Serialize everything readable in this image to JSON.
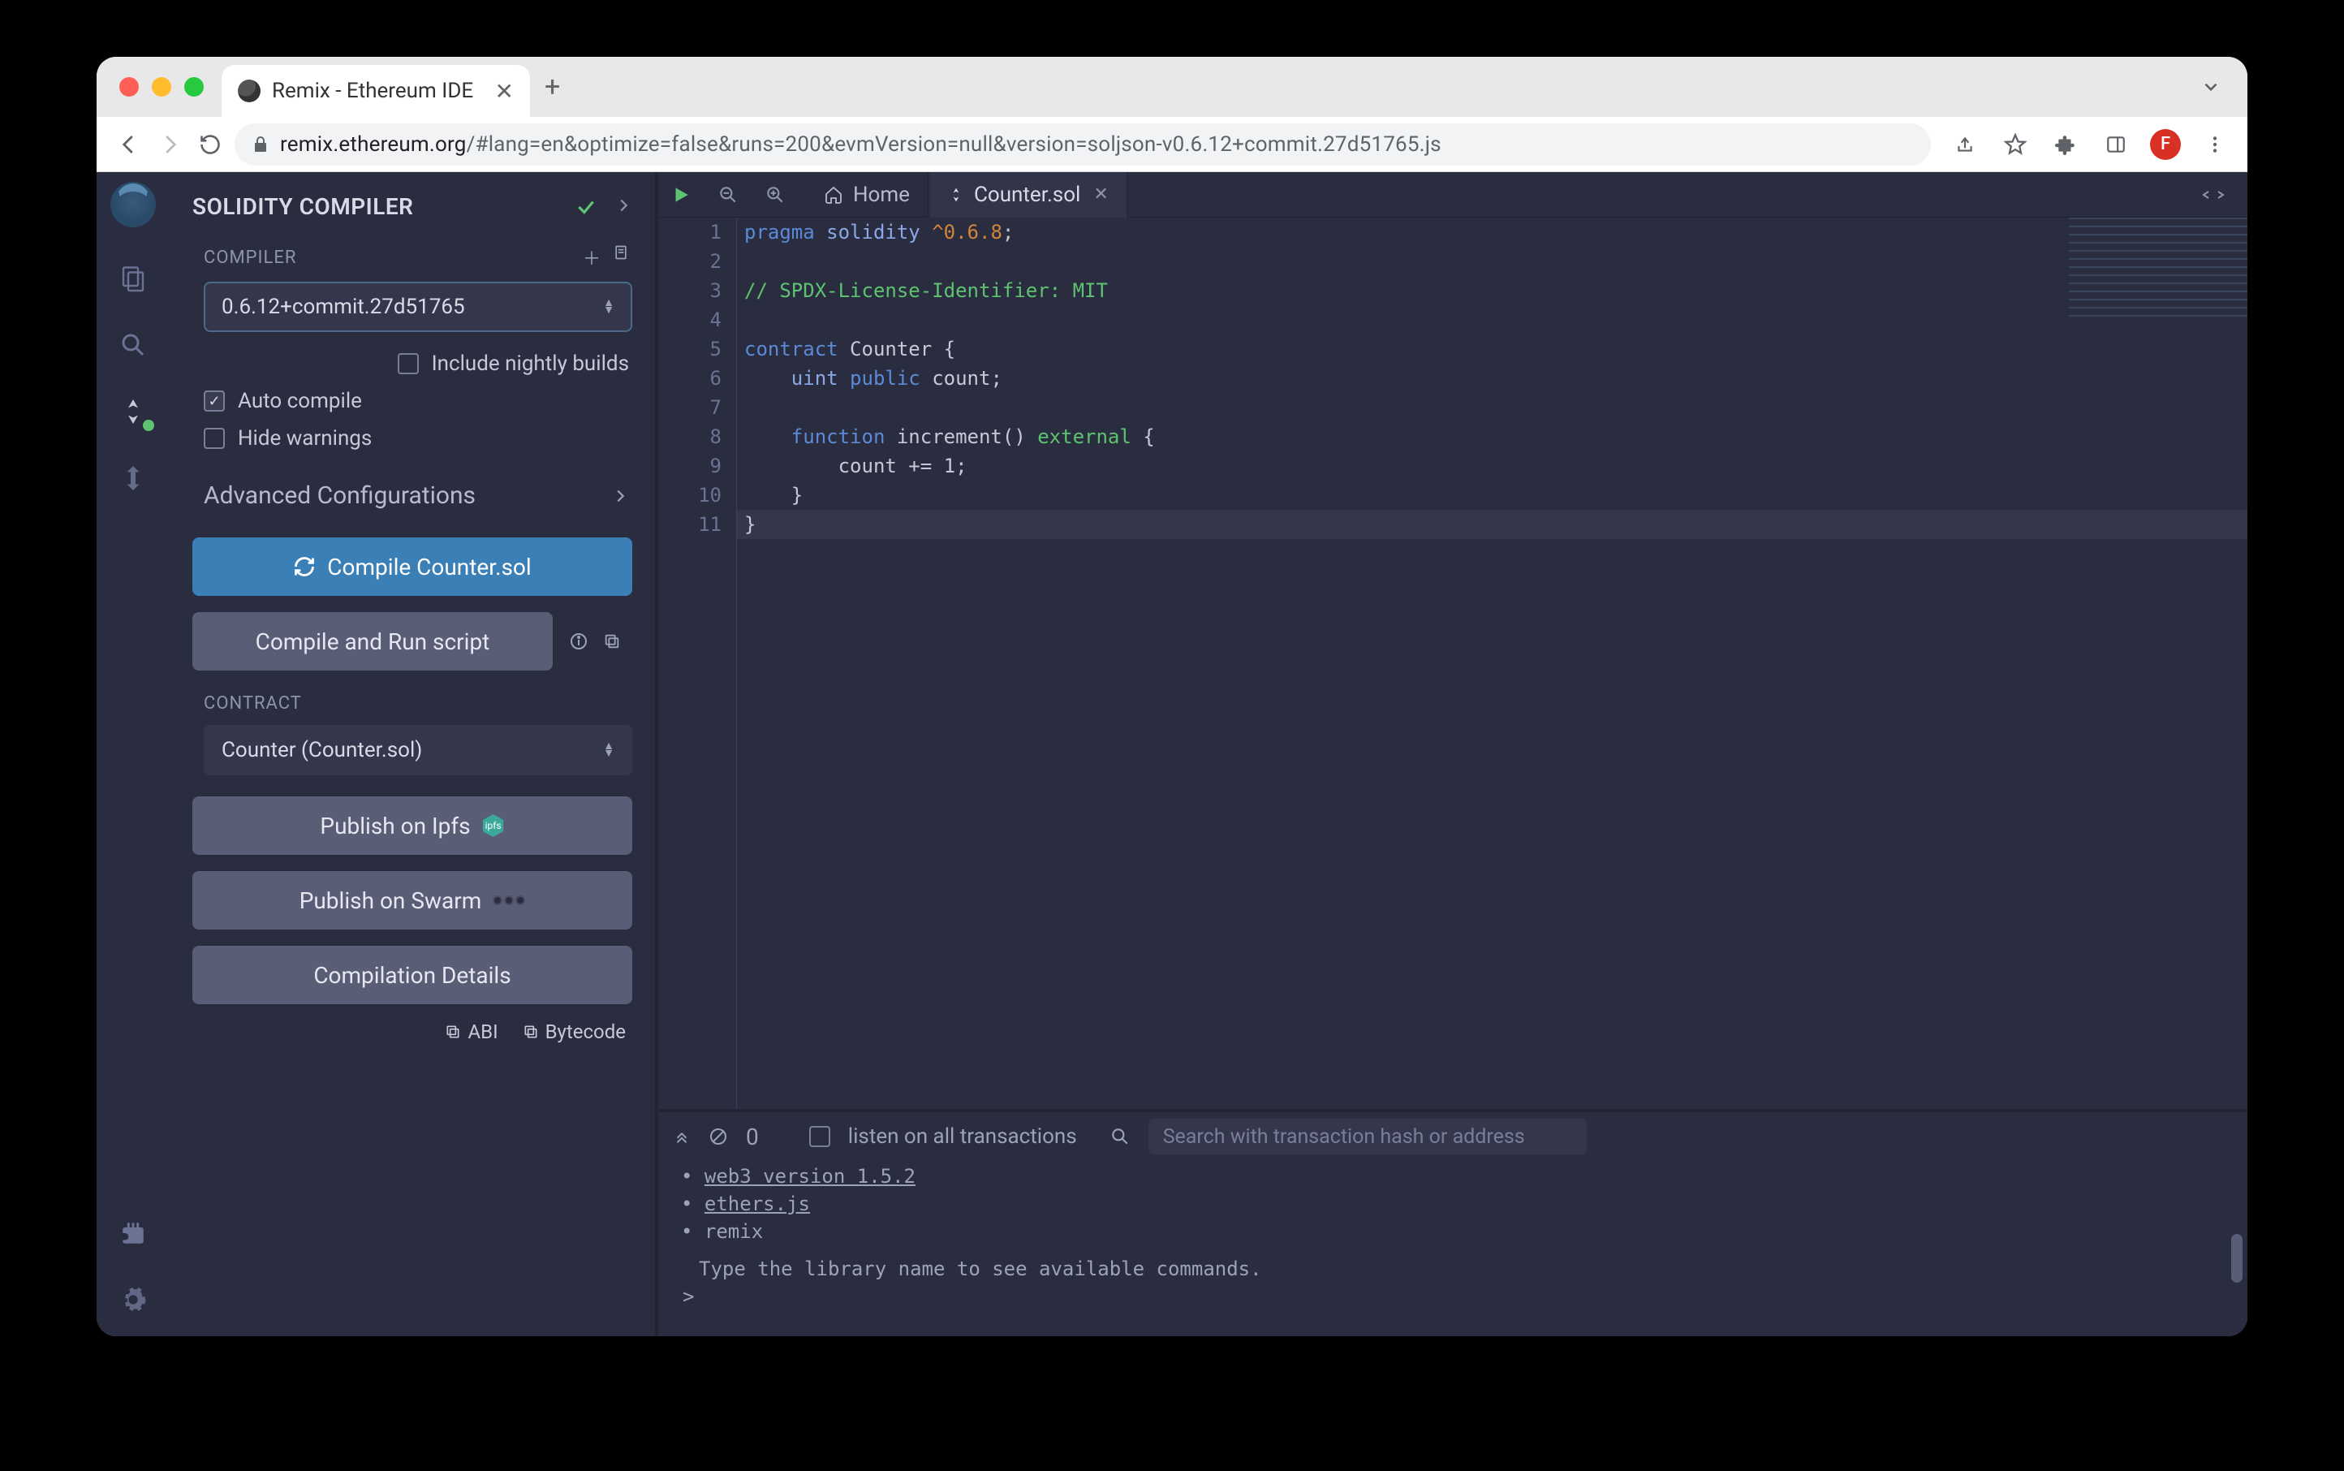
{
  "browser": {
    "tab_title": "Remix - Ethereum IDE",
    "url_domain": "remix.ethereum.org",
    "url_path": "/#lang=en&optimize=false&runs=200&evmVersion=null&version=soljson-v0.6.12+commit.27d51765.js",
    "profile_initial": "F"
  },
  "panel": {
    "title": "SOLIDITY COMPILER",
    "compiler_label": "COMPILER",
    "compiler_version": "0.6.12+commit.27d51765",
    "nightly_label": "Include nightly builds",
    "auto_compile_label": "Auto compile",
    "hide_warnings_label": "Hide warnings",
    "advanced_label": "Advanced Configurations",
    "compile_btn": "Compile Counter.sol",
    "compile_run_btn": "Compile and Run script",
    "contract_label": "CONTRACT",
    "contract_value": "Counter (Counter.sol)",
    "publish_ipfs": "Publish on Ipfs",
    "publish_swarm": "Publish on Swarm",
    "compilation_details": "Compilation Details",
    "abi_label": "ABI",
    "bytecode_label": "Bytecode"
  },
  "editor": {
    "home_tab": "Home",
    "file_tab": "Counter.sol",
    "code": {
      "l1_pragma": "pragma",
      "l1_sol": "solidity",
      "l1_ver": "^0.6.8",
      "l1_semi": ";",
      "l3": "// SPDX-License-Identifier: MIT",
      "l5_kw": "contract",
      "l5_name": " Counter {",
      "l6_type": "uint",
      "l6_pub": "public",
      "l6_rest": " count;",
      "l8_fn": "function",
      "l8_name": " increment() ",
      "l8_ext": "external",
      "l8_brace": " {",
      "l9": "count += 1;",
      "l10": "}",
      "l11": "}"
    }
  },
  "terminal": {
    "pending_count": "0",
    "listen_label": "listen on all transactions",
    "search_placeholder": "Search with transaction hash or address",
    "lines": {
      "web3": "web3 version 1.5.2",
      "ethers": "ethers.js",
      "remix": "remix",
      "hint": "Type the library name to see available commands.",
      "prompt": ">"
    }
  }
}
